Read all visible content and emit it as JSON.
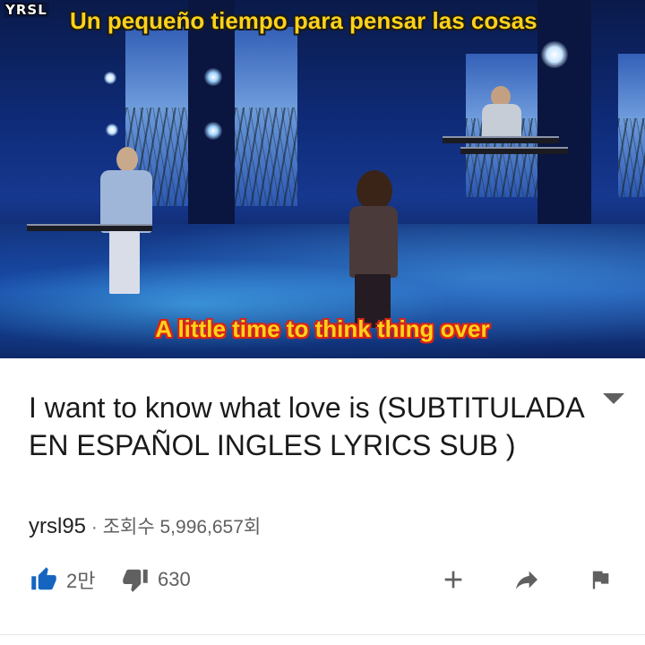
{
  "player": {
    "watermark": "YRSL",
    "subtitle_top": "Un pequeño tiempo para pensar las cosas",
    "subtitle_bottom": "A little time to think thing over"
  },
  "video": {
    "title": "I want to know what love is (SUBTITULADA EN ESPAÑOL INGLES LYRICS SUB )",
    "channel": "yrsl95",
    "separator": "·",
    "views": "조회수 5,996,657회"
  },
  "actions": {
    "like_count": "2만",
    "dislike_count": "630",
    "like_icon": "thumbs-up-icon",
    "dislike_icon": "thumbs-down-icon",
    "add_icon": "plus-icon",
    "share_icon": "share-arrow-icon",
    "report_icon": "flag-icon",
    "expand_icon": "caret-down-icon"
  },
  "colors": {
    "like_active": "#1565c0",
    "icon_gray": "#606060",
    "subtitle_yellow": "#ffd21a",
    "subtitle_outline_red": "#d82418"
  }
}
